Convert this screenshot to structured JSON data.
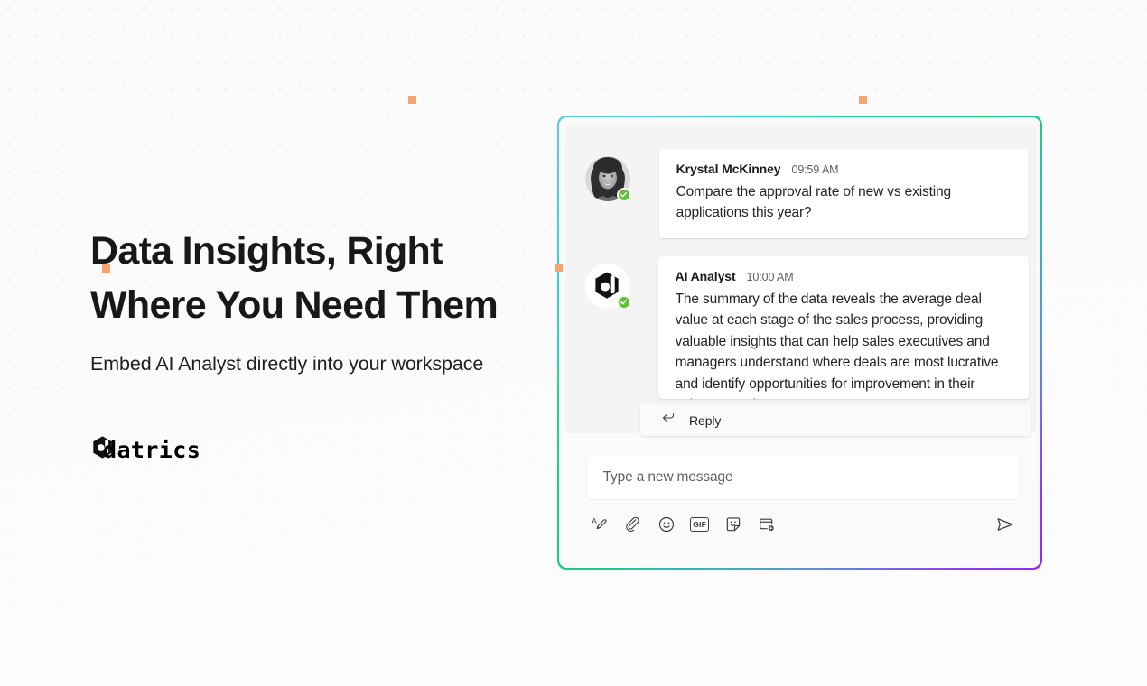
{
  "page": {
    "background_color": "#fbfbfb",
    "accent_color": "#f6a472"
  },
  "hero": {
    "headline_line1": "Data Insights, Right",
    "headline_line2": "Where You Need Them",
    "subheadline": "Embed AI Analyst directly into your workspace",
    "brand_name": "datrics"
  },
  "chat_panel": {
    "border_gradient": {
      "start": "#5ec8ef",
      "mid": "#17d07a",
      "end": "#8b2ef5"
    },
    "messages": [
      {
        "author": "Krystal McKinney",
        "timestamp": "09:59 AM",
        "text": "Compare the approval rate of new vs existing applications this year?",
        "avatar_type": "photo-avatar",
        "presence": "available"
      },
      {
        "author": "AI Analyst",
        "timestamp": "10:00 AM",
        "text": "The summary of the data reveals the average deal value at each stage of the sales process, providing valuable insights that can help sales executives and managers understand where deals are most lucrative and identify opportunities for improvement in their sales strategies.",
        "avatar_type": "datrics-logo-avatar",
        "presence": "available",
        "reply_label": "Reply"
      }
    ],
    "composer": {
      "placeholder": "Type a new message",
      "value": "",
      "tools": [
        {
          "name": "format-icon",
          "label": "Format"
        },
        {
          "name": "attach-icon",
          "label": "Attach"
        },
        {
          "name": "emoji-icon",
          "label": "Emoji"
        },
        {
          "name": "gif-icon",
          "label": "GIF"
        },
        {
          "name": "sticker-icon",
          "label": "Sticker"
        },
        {
          "name": "apps-icon",
          "label": "Apps"
        }
      ],
      "send_label": "Send"
    }
  }
}
